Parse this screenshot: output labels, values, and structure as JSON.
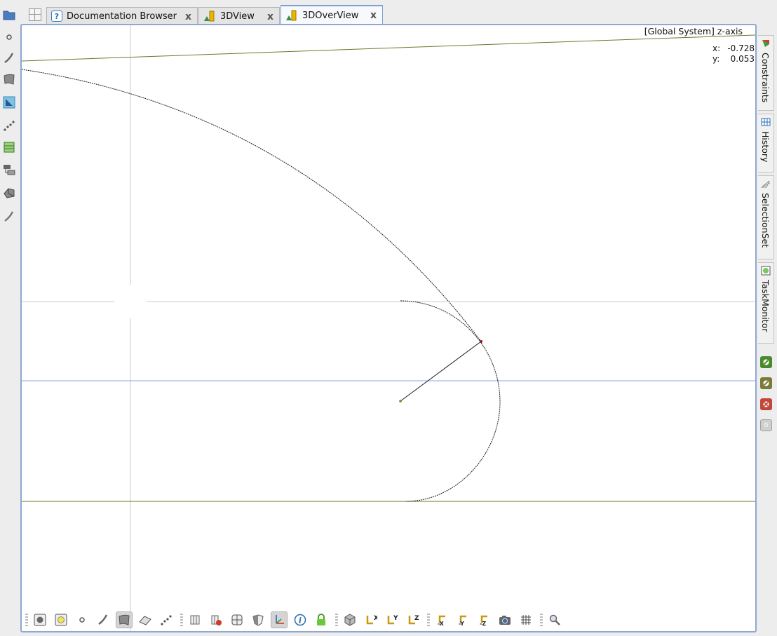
{
  "left_tools": [
    {
      "name": "folder-icon"
    },
    {
      "name": "point-icon"
    },
    {
      "name": "curve-icon"
    },
    {
      "name": "surface-icon"
    },
    {
      "name": "sketch-icon"
    },
    {
      "name": "point-cloud-icon"
    },
    {
      "name": "layers-icon"
    },
    {
      "name": "assembly-icon"
    },
    {
      "name": "solid-icon"
    },
    {
      "name": "curve2-icon"
    }
  ],
  "tabs": [
    {
      "label": "Documentation Browser",
      "icon": "help-icon",
      "close": "x"
    },
    {
      "label": "3DView",
      "icon": "3dview-icon",
      "close": "x"
    },
    {
      "label": "3DOverView",
      "icon": "3dview-icon",
      "close": "x",
      "active": true
    }
  ],
  "viewport": {
    "header": "[Global System] z-axis",
    "coords": {
      "x_label": "x:",
      "x_value": "-0.728",
      "y_label": "y:",
      "y_value": "0.053"
    }
  },
  "right_dock": [
    {
      "label": "Constraints",
      "icon": "constraints-icon"
    },
    {
      "label": "History",
      "icon": "history-icon"
    },
    {
      "label": "SelectionSet",
      "icon": "selection-icon"
    },
    {
      "label": "TaskMonitor",
      "icon": "taskmonitor-icon"
    }
  ],
  "status_icons": [
    {
      "name": "status-green-icon",
      "color": "#4a8a2e"
    },
    {
      "name": "status-olive-icon",
      "color": "#7a7a3a"
    },
    {
      "name": "status-red-icon",
      "color": "#c0473a"
    },
    {
      "name": "status-count-badge",
      "text": "0"
    }
  ],
  "colors": {
    "accent": "#8fa7d3",
    "curve": "#1a1a1a",
    "axis_olive": "#6b7a2a",
    "grid": "#c8c8c8",
    "blue_line": "#8da0e0"
  }
}
